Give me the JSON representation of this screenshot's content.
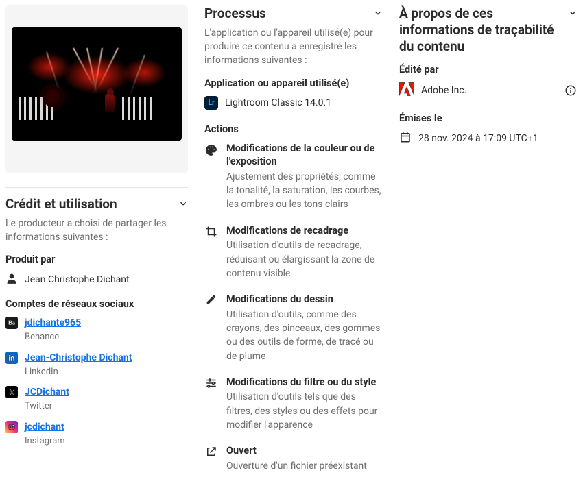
{
  "credit": {
    "heading": "Crédit et utilisation",
    "subtext": "Le producteur a choisi de partager les informations suivantes :",
    "producedByLabel": "Produit par",
    "producedByValue": "Jean Christophe Dichant",
    "socialLabel": "Comptes de réseaux sociaux",
    "socials": [
      {
        "handle": "jdichante965",
        "platform": "Behance"
      },
      {
        "handle": "Jean-Christophe Dichant",
        "platform": "LinkedIn"
      },
      {
        "handle": "JCDichant",
        "platform": "Twitter"
      },
      {
        "handle": "jcdichant",
        "platform": "Instagram"
      }
    ]
  },
  "process": {
    "heading": "Processus",
    "subtext": "L'application ou l'appareil utilisé(e) pour produire ce contenu a enregistré les informations suivantes :",
    "appLabel": "Application ou appareil utilisé(e)",
    "appName": "Lightroom Classic 14.0.1",
    "actionsLabel": "Actions",
    "actions": [
      {
        "title": "Modifications de la couleur ou de l'exposition",
        "desc": "Ajustement des propriétés, comme la tonalité, la saturation, les courbes, les ombres ou les tons clairs"
      },
      {
        "title": "Modifications de recadrage",
        "desc": "Utilisation d'outils de recadrage, réduisant ou élargissant la zone de contenu visible"
      },
      {
        "title": "Modifications du dessin",
        "desc": "Utilisation d'outils, comme des crayons, des pinceaux, des gommes ou des outils de forme, de tracé ou de plume"
      },
      {
        "title": "Modifications du filtre ou du style",
        "desc": "Utilisation d'outils tels que des filtres, des styles ou des effets pour modifier l'apparence"
      },
      {
        "title": "Ouvert",
        "desc": "Ouverture d'un fichier préexistant"
      }
    ]
  },
  "about": {
    "heading": "À propos de ces informations de traçabilité du contenu",
    "editedByLabel": "Édité par",
    "editedByValue": "Adobe Inc.",
    "issuedLabel": "Émises le",
    "issuedValue": "28 nov. 2024 à 17:09 UTC+1"
  }
}
